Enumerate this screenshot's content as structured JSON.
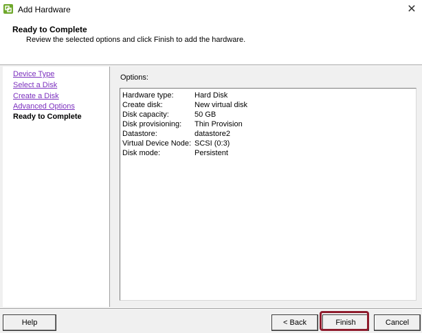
{
  "window": {
    "title": "Add Hardware",
    "close_glyph": "✕",
    "icon": "vsphere-hardware-icon"
  },
  "header": {
    "title": "Ready to Complete",
    "subtitle": "Review the selected options and click Finish to add the hardware."
  },
  "steps": [
    {
      "label": "Device Type",
      "current": false
    },
    {
      "label": "Select a Disk",
      "current": false
    },
    {
      "label": "Create a Disk",
      "current": false
    },
    {
      "label": "Advanced Options",
      "current": false
    },
    {
      "label": "Ready to Complete",
      "current": true
    }
  ],
  "content": {
    "options_label": "Options:",
    "rows": [
      {
        "key": "Hardware type:",
        "value": "Hard Disk"
      },
      {
        "key": "Create disk:",
        "value": "New virtual disk"
      },
      {
        "key": "Disk capacity:",
        "value": "50 GB"
      },
      {
        "key": "Disk provisioning:",
        "value": "Thin Provision"
      },
      {
        "key": "Datastore:",
        "value": "datastore2"
      },
      {
        "key": "Virtual Device Node:",
        "value": "SCSI (0:3)"
      },
      {
        "key": "Disk mode:",
        "value": "Persistent"
      }
    ]
  },
  "buttons": {
    "help": "Help",
    "back": "< Back",
    "finish": "Finish",
    "cancel": "Cancel"
  },
  "colors": {
    "link": "#7b2fbe",
    "finish_highlight": "#8e1b2c"
  }
}
